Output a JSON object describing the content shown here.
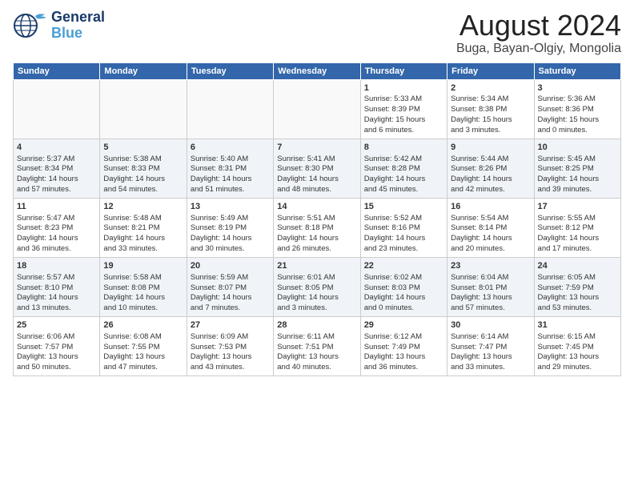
{
  "header": {
    "logo_line1": "General",
    "logo_line2": "Blue",
    "main_title": "August 2024",
    "subtitle": "Buga, Bayan-Olgiy, Mongolia"
  },
  "days_of_week": [
    "Sunday",
    "Monday",
    "Tuesday",
    "Wednesday",
    "Thursday",
    "Friday",
    "Saturday"
  ],
  "weeks": [
    [
      {
        "day": "",
        "info": ""
      },
      {
        "day": "",
        "info": ""
      },
      {
        "day": "",
        "info": ""
      },
      {
        "day": "",
        "info": ""
      },
      {
        "day": "1",
        "info": "Sunrise: 5:33 AM\nSunset: 8:39 PM\nDaylight: 15 hours\nand 6 minutes."
      },
      {
        "day": "2",
        "info": "Sunrise: 5:34 AM\nSunset: 8:38 PM\nDaylight: 15 hours\nand 3 minutes."
      },
      {
        "day": "3",
        "info": "Sunrise: 5:36 AM\nSunset: 8:36 PM\nDaylight: 15 hours\nand 0 minutes."
      }
    ],
    [
      {
        "day": "4",
        "info": "Sunrise: 5:37 AM\nSunset: 8:34 PM\nDaylight: 14 hours\nand 57 minutes."
      },
      {
        "day": "5",
        "info": "Sunrise: 5:38 AM\nSunset: 8:33 PM\nDaylight: 14 hours\nand 54 minutes."
      },
      {
        "day": "6",
        "info": "Sunrise: 5:40 AM\nSunset: 8:31 PM\nDaylight: 14 hours\nand 51 minutes."
      },
      {
        "day": "7",
        "info": "Sunrise: 5:41 AM\nSunset: 8:30 PM\nDaylight: 14 hours\nand 48 minutes."
      },
      {
        "day": "8",
        "info": "Sunrise: 5:42 AM\nSunset: 8:28 PM\nDaylight: 14 hours\nand 45 minutes."
      },
      {
        "day": "9",
        "info": "Sunrise: 5:44 AM\nSunset: 8:26 PM\nDaylight: 14 hours\nand 42 minutes."
      },
      {
        "day": "10",
        "info": "Sunrise: 5:45 AM\nSunset: 8:25 PM\nDaylight: 14 hours\nand 39 minutes."
      }
    ],
    [
      {
        "day": "11",
        "info": "Sunrise: 5:47 AM\nSunset: 8:23 PM\nDaylight: 14 hours\nand 36 minutes."
      },
      {
        "day": "12",
        "info": "Sunrise: 5:48 AM\nSunset: 8:21 PM\nDaylight: 14 hours\nand 33 minutes."
      },
      {
        "day": "13",
        "info": "Sunrise: 5:49 AM\nSunset: 8:19 PM\nDaylight: 14 hours\nand 30 minutes."
      },
      {
        "day": "14",
        "info": "Sunrise: 5:51 AM\nSunset: 8:18 PM\nDaylight: 14 hours\nand 26 minutes."
      },
      {
        "day": "15",
        "info": "Sunrise: 5:52 AM\nSunset: 8:16 PM\nDaylight: 14 hours\nand 23 minutes."
      },
      {
        "day": "16",
        "info": "Sunrise: 5:54 AM\nSunset: 8:14 PM\nDaylight: 14 hours\nand 20 minutes."
      },
      {
        "day": "17",
        "info": "Sunrise: 5:55 AM\nSunset: 8:12 PM\nDaylight: 14 hours\nand 17 minutes."
      }
    ],
    [
      {
        "day": "18",
        "info": "Sunrise: 5:57 AM\nSunset: 8:10 PM\nDaylight: 14 hours\nand 13 minutes."
      },
      {
        "day": "19",
        "info": "Sunrise: 5:58 AM\nSunset: 8:08 PM\nDaylight: 14 hours\nand 10 minutes."
      },
      {
        "day": "20",
        "info": "Sunrise: 5:59 AM\nSunset: 8:07 PM\nDaylight: 14 hours\nand 7 minutes."
      },
      {
        "day": "21",
        "info": "Sunrise: 6:01 AM\nSunset: 8:05 PM\nDaylight: 14 hours\nand 3 minutes."
      },
      {
        "day": "22",
        "info": "Sunrise: 6:02 AM\nSunset: 8:03 PM\nDaylight: 14 hours\nand 0 minutes."
      },
      {
        "day": "23",
        "info": "Sunrise: 6:04 AM\nSunset: 8:01 PM\nDaylight: 13 hours\nand 57 minutes."
      },
      {
        "day": "24",
        "info": "Sunrise: 6:05 AM\nSunset: 7:59 PM\nDaylight: 13 hours\nand 53 minutes."
      }
    ],
    [
      {
        "day": "25",
        "info": "Sunrise: 6:06 AM\nSunset: 7:57 PM\nDaylight: 13 hours\nand 50 minutes."
      },
      {
        "day": "26",
        "info": "Sunrise: 6:08 AM\nSunset: 7:55 PM\nDaylight: 13 hours\nand 47 minutes."
      },
      {
        "day": "27",
        "info": "Sunrise: 6:09 AM\nSunset: 7:53 PM\nDaylight: 13 hours\nand 43 minutes."
      },
      {
        "day": "28",
        "info": "Sunrise: 6:11 AM\nSunset: 7:51 PM\nDaylight: 13 hours\nand 40 minutes."
      },
      {
        "day": "29",
        "info": "Sunrise: 6:12 AM\nSunset: 7:49 PM\nDaylight: 13 hours\nand 36 minutes."
      },
      {
        "day": "30",
        "info": "Sunrise: 6:14 AM\nSunset: 7:47 PM\nDaylight: 13 hours\nand 33 minutes."
      },
      {
        "day": "31",
        "info": "Sunrise: 6:15 AM\nSunset: 7:45 PM\nDaylight: 13 hours\nand 29 minutes."
      }
    ]
  ]
}
